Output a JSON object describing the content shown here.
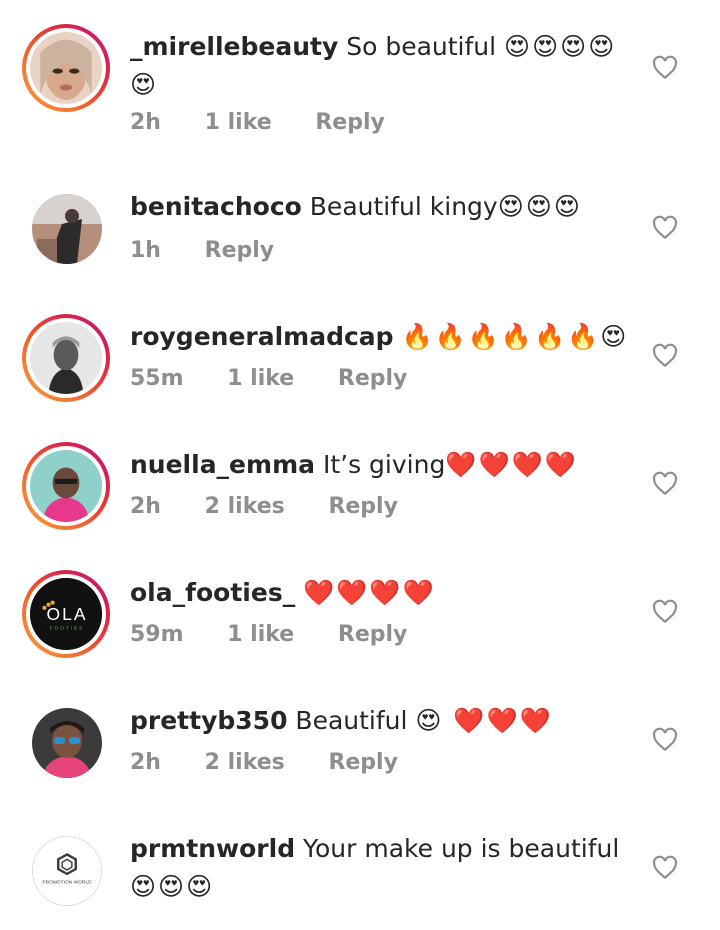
{
  "comments": [
    {
      "username": "_mirellebeauty",
      "text": "So beautiful",
      "emoji": "😍😍😍😍😍",
      "time": "2h",
      "likes": "1 like",
      "reply": "Reply",
      "avatar": "face-avatar",
      "ring": true
    },
    {
      "username": "benitachoco",
      "text": "Beautiful kingy",
      "emoji": "😍😍😍",
      "time": "1h",
      "likes": "",
      "reply": "Reply",
      "avatar": "studio-avatar",
      "ring": false
    },
    {
      "username": "roygeneralmadcap",
      "text": "",
      "emoji": "🔥🔥🔥🔥🔥🔥😍",
      "time": "55m",
      "likes": "1 like",
      "reply": "Reply",
      "avatar": "bw-portrait-avatar",
      "ring": true
    },
    {
      "username": "nuella_emma",
      "text": "It’s giving",
      "emoji": "❤️❤️❤️❤️",
      "time": "2h",
      "likes": "2 likes",
      "reply": "Reply",
      "avatar": "pink-portrait-avatar",
      "ring": true
    },
    {
      "username": "ola_footies_",
      "text": "",
      "emoji": "❤️❤️❤️❤️",
      "time": "59m",
      "likes": "1 like",
      "reply": "Reply",
      "avatar": "ola-logo-avatar",
      "ring": true
    },
    {
      "username": "prettyb350",
      "text": "Beautiful",
      "emoji": "😍 ❤️❤️❤️",
      "time": "2h",
      "likes": "2 likes",
      "reply": "Reply",
      "avatar": "sunglasses-avatar",
      "ring": false
    },
    {
      "username": "prmtnworld",
      "text": "Your make up is beautiful",
      "emoji": "😍😍😍",
      "time": "",
      "likes": "",
      "reply": "",
      "avatar": "promotion-world-logo-avatar",
      "ring": false
    }
  ],
  "logos": {
    "ola": "OLA",
    "ola_sub": "FOOTIES",
    "promo": "PROMOTION WORLD"
  },
  "colors": {
    "meta": "#8e8e8e",
    "text": "#262626",
    "ring_start": "#f9a33b",
    "ring_end": "#bc1888"
  }
}
